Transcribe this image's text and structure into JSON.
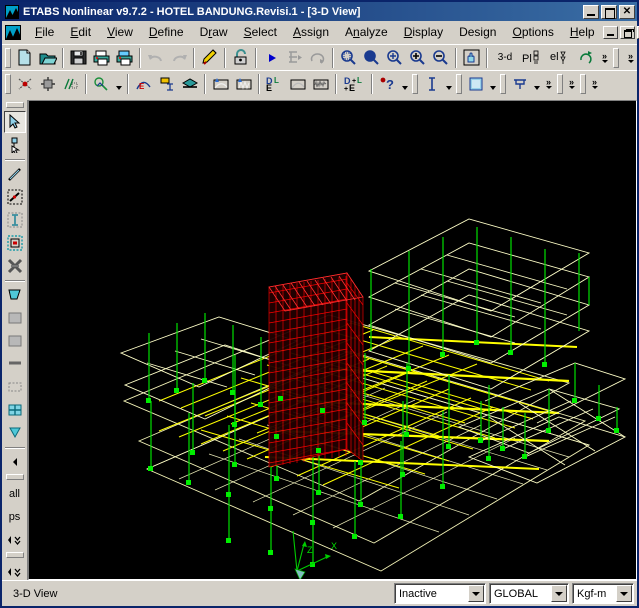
{
  "window": {
    "title": "ETABS Nonlinear v9.7.2 - HOTEL BANDUNG.Revisi.1 - [3-D View]",
    "app_icon": "etabs-logo-icon",
    "minimize_label": "",
    "maximize_label": "",
    "close_label": "✕"
  },
  "menubar": {
    "items": [
      {
        "label": "File",
        "accel": "F"
      },
      {
        "label": "Edit",
        "accel": "E"
      },
      {
        "label": "View",
        "accel": "V"
      },
      {
        "label": "Define",
        "accel": "D"
      },
      {
        "label": "Draw",
        "accel": "r"
      },
      {
        "label": "Select",
        "accel": "S"
      },
      {
        "label": "Assign",
        "accel": "A"
      },
      {
        "label": "Analyze",
        "accel": "n"
      },
      {
        "label": "Display",
        "accel": "D"
      },
      {
        "label": "Design",
        "accel": "g"
      },
      {
        "label": "Options",
        "accel": "O"
      },
      {
        "label": "Help",
        "accel": "H"
      }
    ],
    "mdi_minimize": "",
    "mdi_restore": "",
    "mdi_close": "✕"
  },
  "toolbar_main": {
    "buttons": [
      {
        "name": "new-model-button",
        "tooltip": "New Model"
      },
      {
        "name": "open-file-button",
        "tooltip": "Open File"
      },
      {
        "name": "save-button",
        "tooltip": "Save"
      },
      {
        "name": "print-graphics-button",
        "tooltip": "Print Graphics"
      },
      {
        "name": "print-tables-button",
        "tooltip": "Print Tables"
      },
      {
        "name": "undo-button",
        "tooltip": "Undo"
      },
      {
        "name": "redo-button",
        "tooltip": "Redo"
      },
      {
        "name": "edit-grid-button",
        "tooltip": "Edit Grid Data"
      },
      {
        "name": "lock-unlock-model-button",
        "tooltip": "Lock/Unlock Model"
      },
      {
        "name": "run-analysis-button",
        "tooltip": "Run Analysis"
      },
      {
        "name": "run-static-button",
        "tooltip": "Run Static Nonlinear Analysis"
      },
      {
        "name": "rerun-button",
        "tooltip": "Re-run Analysis"
      },
      {
        "name": "rubber-band-zoom-button",
        "tooltip": "Rubber Band Zoom"
      },
      {
        "name": "restore-full-view-button",
        "tooltip": "Restore Full View"
      },
      {
        "name": "previous-zoom-button",
        "tooltip": "Previous Zoom"
      },
      {
        "name": "zoom-in-button",
        "tooltip": "Zoom In One Step"
      },
      {
        "name": "zoom-out-button",
        "tooltip": "Zoom Out One Step"
      },
      {
        "name": "pan-button",
        "tooltip": "Pan"
      },
      {
        "name": "view-3d-button",
        "label": "3-d",
        "tooltip": "3-D View"
      },
      {
        "name": "view-plan-button",
        "label": "Pl",
        "tooltip": "Plan View"
      },
      {
        "name": "view-elevation-button",
        "label": "el",
        "tooltip": "Elevation View"
      },
      {
        "name": "rotate-3d-view-button",
        "tooltip": "Set 3D View"
      }
    ],
    "overflow_label": "»"
  },
  "toolbar_second": {
    "buttons": [
      {
        "name": "set-building-view-options-button",
        "tooltip": "Set Building View Options"
      },
      {
        "name": "perspective-toggle-button",
        "tooltip": "Set Perspective"
      },
      {
        "name": "object-shrink-button",
        "tooltip": "Shrink Objects"
      },
      {
        "name": "show-undeformed-shape-button",
        "tooltip": "Show Undeformed Shape"
      },
      {
        "name": "assign-section-button",
        "tooltip": "Assign Frame Section"
      },
      {
        "name": "label-objects-button",
        "tooltip": "Label Objects"
      },
      {
        "name": "section-cut-button",
        "tooltip": "Section Cut"
      },
      {
        "name": "show-deformed-shape-button",
        "tooltip": "Show Deformed Shape"
      },
      {
        "name": "show-mode-shape-button",
        "tooltip": "Show Mode Shape"
      },
      {
        "name": "member-force-diagram-button",
        "tooltip": "Member Force Diagram"
      },
      {
        "name": "show-response-spectrum-button",
        "tooltip": "Show Response Spectrum Curves"
      },
      {
        "name": "time-history-traces-button",
        "tooltip": "Show Time History Traces"
      },
      {
        "name": "show-energy-diagram-button",
        "tooltip": "Show Energy Diagram"
      },
      {
        "name": "help-pointer-button",
        "tooltip": "Context Help"
      },
      {
        "name": "text-mode-button",
        "tooltip": "Set Display Text"
      },
      {
        "name": "fill-objects-button",
        "tooltip": "Fill Objects"
      },
      {
        "name": "extrude-view-button",
        "tooltip": "Extrude View"
      }
    ],
    "overflow_label": "»"
  },
  "sidebar": {
    "items": [
      {
        "name": "sidebar-pointer-tool",
        "icon": "arrow-pointer-icon",
        "state": "pressed"
      },
      {
        "name": "sidebar-reshape-tool",
        "icon": "reshape-object-icon",
        "state": "normal"
      },
      {
        "name": "sidebar-draw-line-tool",
        "icon": "draw-line-icon",
        "state": "normal"
      },
      {
        "name": "sidebar-draw-line-area-tool",
        "icon": "draw-line-in-region-icon",
        "state": "normal"
      },
      {
        "name": "sidebar-draw-column-tool",
        "icon": "draw-column-icon",
        "state": "normal"
      },
      {
        "name": "sidebar-draw-secondary-tool",
        "icon": "draw-secondary-beam-icon",
        "state": "normal"
      },
      {
        "name": "sidebar-draw-brace-tool",
        "icon": "draw-brace-icon",
        "state": "normal"
      },
      {
        "name": "sidebar-draw-area-tool",
        "icon": "draw-area-icon",
        "state": "normal"
      },
      {
        "name": "sidebar-draw-rect-area-tool",
        "icon": "draw-rect-area-icon",
        "state": "normal"
      },
      {
        "name": "sidebar-quick-area-tool",
        "icon": "quick-draw-area-icon",
        "state": "normal"
      },
      {
        "name": "sidebar-draw-wall-tool",
        "icon": "draw-wall-icon",
        "state": "normal"
      },
      {
        "name": "sidebar-draw-opening-tool",
        "icon": "draw-opening-icon",
        "state": "normal"
      },
      {
        "name": "sidebar-quick-mesh-tool",
        "icon": "quick-mesh-icon",
        "state": "normal"
      },
      {
        "name": "sidebar-draw-ramp-tool",
        "icon": "draw-ramp-icon",
        "state": "normal"
      },
      {
        "name": "sidebar-scroll-left",
        "icon": "scroll-left-icon",
        "state": "normal"
      },
      {
        "name": "sidebar-select-all",
        "icon": "select-all-icon",
        "label": "all",
        "state": "normal"
      },
      {
        "name": "sidebar-previous-selection",
        "icon": "previous-selection-icon",
        "label": "ps",
        "state": "normal"
      },
      {
        "name": "sidebar-overflow-1",
        "icon": "overflow-chevron-icon",
        "state": "normal"
      },
      {
        "name": "sidebar-overflow-2",
        "icon": "overflow-chevron-icon",
        "state": "normal"
      }
    ]
  },
  "viewport": {
    "name": "3d-model-viewport",
    "background": "#000000",
    "axis_labels": {
      "z": "Z",
      "x": "X"
    },
    "colors": {
      "beams": "#ffff00",
      "columns": "#00d000",
      "slabs": "#ffffcc",
      "walls": "#ff0000",
      "joints": "#00ee00",
      "axis": "#00cc00"
    },
    "model_title": "HOTEL BANDUNG.Revisi.1"
  },
  "statusbar": {
    "view_label": "3-D View",
    "selection_state": {
      "value": "Inactive",
      "name": "status-selection-combo"
    },
    "coordinate_system": {
      "value": "GLOBAL",
      "name": "status-coordinate-combo"
    },
    "units": {
      "value": "Kgf-m",
      "name": "status-units-combo"
    }
  }
}
